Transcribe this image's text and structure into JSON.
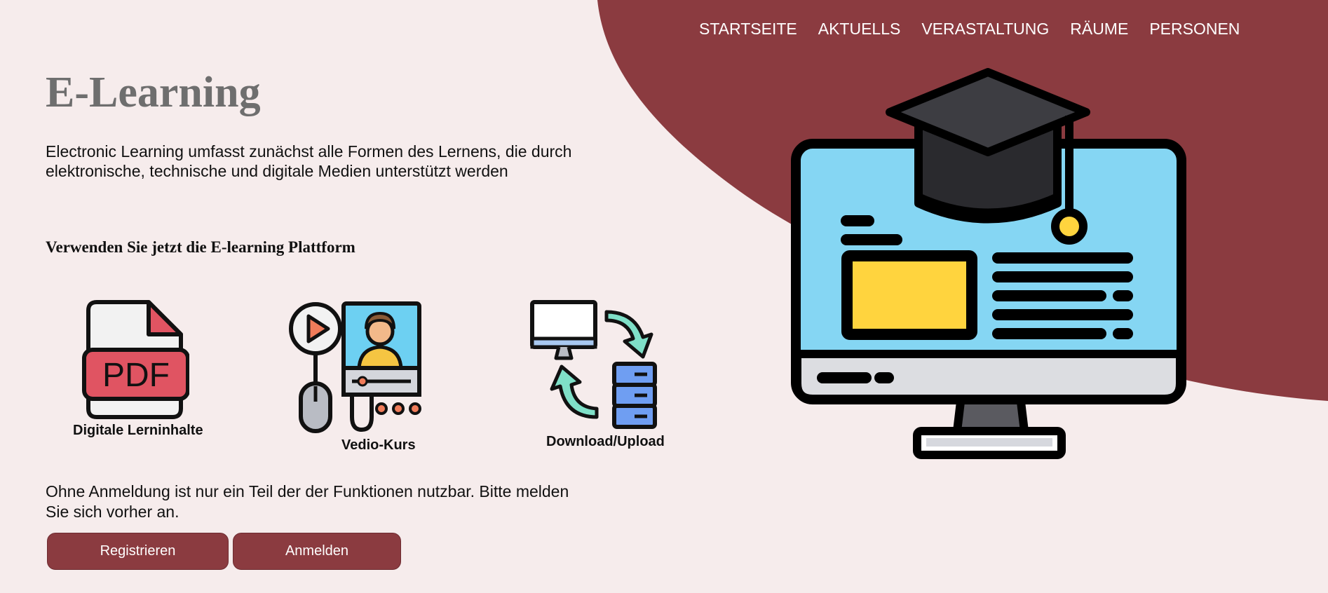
{
  "nav": {
    "items": [
      {
        "label": "STARTSEITE"
      },
      {
        "label": "AKTUELLS"
      },
      {
        "label": "VERASTALTUNG"
      },
      {
        "label": "RÄUME"
      },
      {
        "label": "PERSONEN"
      }
    ]
  },
  "main": {
    "title": "E-Learning",
    "intro": "Electronic Learning umfasst zunächst alle Formen des Lernens, die durch elektronische, technische und digitale Medien unterstützt werden",
    "subheading": "Verwenden Sie jetzt die E-learning Plattform",
    "features": [
      {
        "icon": "pdf-document-icon",
        "caption": "Digitale Lerninhalte"
      },
      {
        "icon": "video-course-icon",
        "caption": "Vedio-Kurs"
      },
      {
        "icon": "download-upload-icon",
        "caption": "Download/Upload"
      }
    ],
    "notice": "Ohne Anmeldung ist nur ein Teil der der Funktionen nutzbar. Bitte melden Sie sich vorher an.",
    "buttons": {
      "register": "Registrieren",
      "login": "Anmelden"
    }
  },
  "hero": {
    "icon": "computer-graduation-cap-icon"
  },
  "colors": {
    "background": "#f6ecec",
    "accent": "#8b3b40",
    "title": "#6e6e6e"
  }
}
